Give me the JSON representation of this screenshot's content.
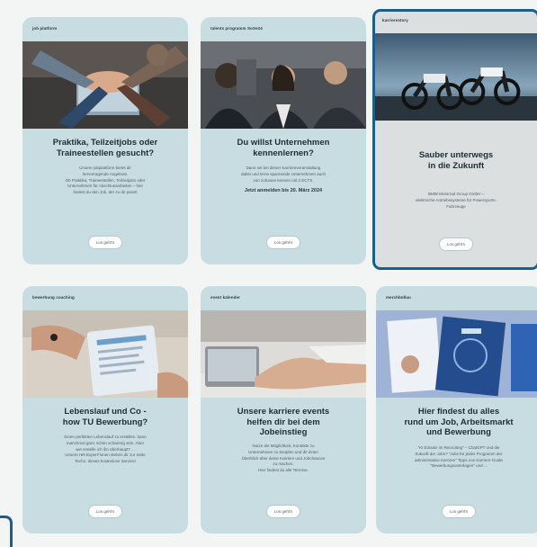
{
  "cards": [
    {
      "tag": "job platform",
      "image": "team-hands-laptop",
      "title": "Praktika, Teilzeitjobs oder\nTraineestellen gesucht?",
      "desc": "Unsere jobplattform bietet dir\nhervorragende Angebote.\nOb Praktika, Traineestellen, Teilzeitjobs oder\nUnternehmen für Abschlussarbeiten – hier\nfindest du den Job, der zu dir passt!",
      "extra": "",
      "button": "Los geht's"
    },
    {
      "tag": "talents programm SoSe24",
      "image": "conference-audience",
      "title": "Du willst Unternehmen\nkennenlernen?",
      "desc": "Dann sei bei dieser Karriereveranstaltung\ndabei und lerne spannende Unternehmen auch\nvon zuhause kennen mit 2 ECTS.",
      "extra": "Jetzt anmelden bis 20. März 2024",
      "button": "Los geht's"
    },
    {
      "tag": "karrierestory",
      "image": "electric-motorbikes",
      "title": "Sauber unterwegs\nin die Zukunft",
      "desc": "BMW Motorrad Group GmbH –\nelektrische Antriebssysteme für Powersports-\nFahrzeuge",
      "extra": "",
      "button": "Los geht's"
    },
    {
      "tag": "bewerbung coaching",
      "image": "resume-tablet",
      "title": "Lebenslauf und Co -\nhow TU Bewerbung?",
      "desc": "Einen perfekten Lebenslauf zu erstellen, kann\nmanchmal ganz schön schwierig sein. Aber\nwie erstelle ich ihn überhaupt? ...\nUnsere HR-Expert*innen stehen dir zur Seite\nTechn. dieses kostenlose Service!",
      "extra": "",
      "button": "Los geht's"
    },
    {
      "tag": "event kalender",
      "image": "handshake",
      "title": "Unsere karriere events\nhelfen dir bei dem\nJobeinstieg",
      "desc": "Nutze die Möglichkeit, Kontakte zu\nUnternehmen zu knüpfen und dir einen\nÜberblick über deine Karriere und Jobchancen\nzu machen.\nHier findest du alle Termine.",
      "extra": "",
      "button": "Los geht's"
    },
    {
      "tag": "merchbüllau",
      "image": "career-magazine",
      "title": "Hier findest du alles\nrund um Job, Arbeitsmarkt\nund Bewerbung",
      "desc": "\"KI Einsatz im Recruiting\" – ChatGPT und die\nZukunft der Jobs? \"Jobs für jedes Programm der\nadministrative Karriere\" Tipps von Karriere-Guide\n\"Bewerbungsunterlagen\" und ...",
      "extra": "",
      "button": "Los geht's"
    }
  ]
}
